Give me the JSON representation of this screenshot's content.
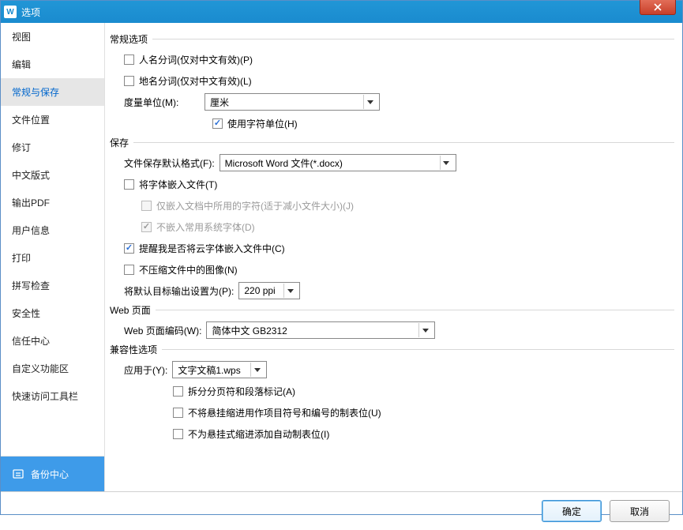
{
  "titlebar": {
    "title": "选项"
  },
  "sidebar": {
    "items": [
      {
        "label": "视图"
      },
      {
        "label": "编辑"
      },
      {
        "label": "常规与保存"
      },
      {
        "label": "文件位置"
      },
      {
        "label": "修订"
      },
      {
        "label": "中文版式"
      },
      {
        "label": "输出PDF"
      },
      {
        "label": "用户信息"
      },
      {
        "label": "打印"
      },
      {
        "label": "拼写检查"
      },
      {
        "label": "安全性"
      },
      {
        "label": "信任中心"
      },
      {
        "label": "自定义功能区"
      },
      {
        "label": "快速访问工具栏"
      }
    ],
    "backup": "备份中心"
  },
  "general": {
    "head": "常规选项",
    "person_split": "人名分词(仅对中文有效)(P)",
    "place_split": "地名分词(仅对中文有效)(L)",
    "unit_label": "度量单位(M):",
    "unit_value": "厘米",
    "use_char_unit": "使用字符单位(H)"
  },
  "save": {
    "head": "保存",
    "default_fmt_label": "文件保存默认格式(F):",
    "default_fmt_value": "Microsoft Word 文件(*.docx)",
    "embed_fonts": "将字体嵌入文件(T)",
    "embed_only_used": "仅嵌入文档中所用的字符(适于减小文件大小)(J)",
    "no_embed_sys": "不嵌入常用系统字体(D)",
    "remind_cloud": "提醒我是否将云字体嵌入文件中(C)",
    "no_compress": "不压缩文件中的图像(N)",
    "default_res_label": "将默认目标输出设置为(P):",
    "default_res_value": "220 ppi"
  },
  "web": {
    "head": "Web 页面",
    "encoding_label": "Web 页面编码(W):",
    "encoding_value": "简体中文 GB2312"
  },
  "compat": {
    "head": "兼容性选项",
    "apply_label": "应用于(Y):",
    "apply_value": "文字文稿1.wps",
    "opt1": "拆分分页符和段落标记(A)",
    "opt2": "不将悬挂缩进用作项目符号和编号的制表位(U)",
    "opt3": "不为悬挂式缩进添加自动制表位(I)"
  },
  "footer": {
    "ok": "确定",
    "cancel": "取消"
  }
}
